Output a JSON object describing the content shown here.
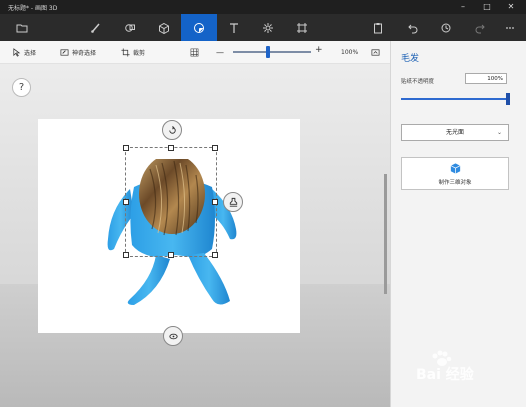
{
  "window": {
    "title": "无标题* - 画图 3D",
    "controls": [
      "minimize-icon",
      "maximize-icon",
      "close-icon"
    ]
  },
  "toolbar": {
    "tools": [
      {
        "icon": "folder-icon"
      },
      {
        "icon": "brush-icon"
      },
      {
        "icon": "shapes-2d-icon"
      },
      {
        "icon": "shapes-3d-icon"
      },
      {
        "icon": "stickers-icon",
        "active": true
      },
      {
        "icon": "text-icon"
      },
      {
        "icon": "effects-icon"
      },
      {
        "icon": "canvas-icon"
      },
      {
        "icon": "paste-icon"
      },
      {
        "icon": "undo-icon"
      },
      {
        "icon": "history-icon"
      },
      {
        "icon": "redo-icon"
      },
      {
        "icon": "more-icon"
      }
    ],
    "active_color": "#1463c8"
  },
  "subbar": {
    "select_label": "选择",
    "magic_select_label": "神奇选择",
    "crop_label": "裁剪",
    "zoom_minus": "—",
    "zoom_plus": "+",
    "zoom_value": "100%",
    "zoom_level": 0.45
  },
  "canvas": {
    "help_label": "?",
    "scene": "3D figure with a wood-grain textured head on a white canvas, selected"
  },
  "panel": {
    "title": "毛发",
    "opacity_label": "贴纸不透明度",
    "opacity_value": "100%",
    "opacity_fraction": 1.0,
    "dropdown_value": "无光面",
    "make3d_label": "制作三维对象"
  },
  "watermark": {
    "text": "Bai 经验"
  }
}
